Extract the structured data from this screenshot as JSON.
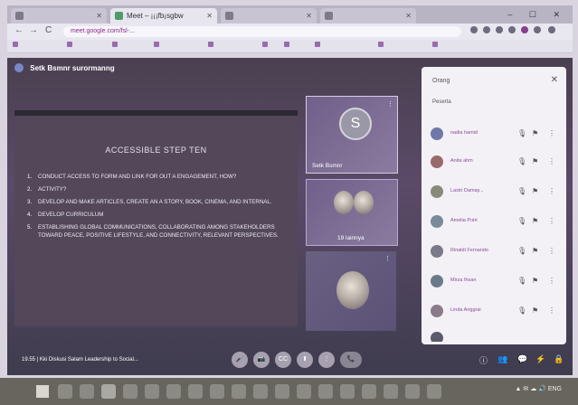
{
  "browser": {
    "tabs": [
      {
        "label": "",
        "active": false
      },
      {
        "label": "Meet – ¡¡¡fb¡sgbw",
        "active": true
      },
      {
        "label": "",
        "active": false
      },
      {
        "label": "",
        "active": false
      }
    ],
    "window_controls": "– ☐ ✕"
  },
  "toolbar": {
    "back": "←",
    "forward": "→",
    "reload": "C",
    "url": "meet.google.com/fsl-..."
  },
  "bookmarks": [
    "",
    "",
    "",
    "",
    "",
    "",
    "",
    "",
    "",
    ""
  ],
  "meet": {
    "header_title": "Setk Bsmnr surormanng",
    "slide": {
      "title": "ACCESSIBLE STEP TEN",
      "items": [
        {
          "number": "1.",
          "text": "CONDUCT ACCESS TO FORM AND LINK FOR OUT A ENGAGEMENT, HOW?"
        },
        {
          "number": "2.",
          "text": "ACTIVITY?"
        },
        {
          "number": "3.",
          "text": "DEVELOP AND MAKE ARTICLES, CREATE AN A STORY, BOOK, CINEMA, AND INTERNAL."
        },
        {
          "number": "4.",
          "text": "DEVELOP CURRICULUM"
        },
        {
          "number": "5.",
          "text": "ESTABLISHING GLOBAL COMMUNICATIONS, COLLABORATING AMONG STAKEHOLDERS TOWARD PEACE, POSITIVE LIFESTYLE, AND CONNECTIVITY, RELEVANT PERSPECTIVES."
        }
      ]
    },
    "tiles": [
      {
        "name": "Setk Bsmnr",
        "initial": "S"
      },
      {
        "name": "19 lainnya"
      },
      {
        "name": ""
      }
    ],
    "panel": {
      "title": "Orang",
      "close": "✕",
      "subtitle": "Peserta",
      "participants": [
        {
          "name": "nadia hamid",
          "color": "#6f78a8"
        },
        {
          "name": "Anita ahm",
          "color": "#9a6a6a"
        },
        {
          "name": "Lastri Damay...",
          "color": "#8a8a7a"
        },
        {
          "name": "Amelia Putri",
          "color": "#7a8a9a"
        },
        {
          "name": "Rinaldi Fernando",
          "color": "#7a7a8a"
        },
        {
          "name": "Mirza Ihsan",
          "color": "#6a7a8a"
        },
        {
          "name": "Linda Anggrai",
          "color": "#8a7a8a"
        },
        {
          "name": "",
          "color": "#5a5a6a"
        }
      ]
    },
    "bottom": {
      "meeting_info": "19.55 | Kki Diskusi Salam Leadership to Social...",
      "controls": [
        "🎤",
        "📷",
        "CC",
        "⬆",
        "⋮",
        "📞"
      ],
      "right_controls": [
        "ⓘ",
        "👥",
        "💬",
        "⚡",
        "🔒"
      ]
    }
  },
  "taskbar": {
    "tray_text": "▲ ✉ ☁ 🔊 ENG",
    "icons": [
      "file-explorer",
      "edge",
      "chrome",
      "word",
      "excel",
      "powerpoint",
      "zoom",
      "teams",
      "vlc",
      "photos",
      "store",
      "settings",
      "notes",
      "camera",
      "paint",
      "mail",
      "calendar",
      "calculator"
    ]
  }
}
